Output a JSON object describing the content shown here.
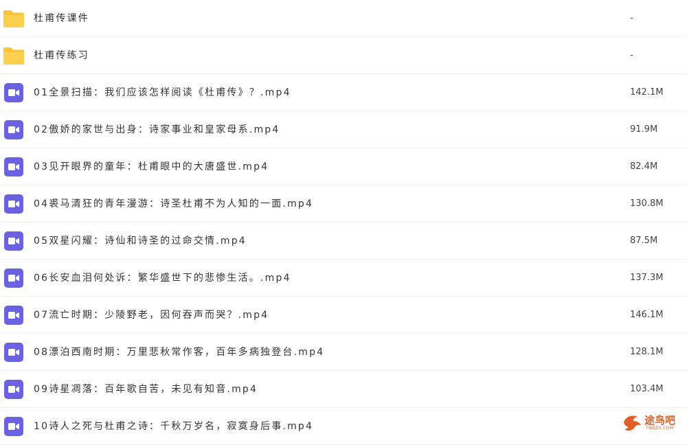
{
  "files": [
    {
      "type": "folder",
      "icon": "folder-icon",
      "name": "杜甫传课件",
      "size": "-"
    },
    {
      "type": "folder",
      "icon": "folder-icon",
      "name": "杜甫传练习",
      "size": "-"
    },
    {
      "type": "video",
      "icon": "video-icon",
      "name": "01全景扫描：我们应该怎样阅读《杜甫传》？.mp4",
      "size": "142.1M"
    },
    {
      "type": "video",
      "icon": "video-icon",
      "name": "02傲娇的家世与出身：诗家事业和皇家母系.mp4",
      "size": "91.9M"
    },
    {
      "type": "video",
      "icon": "video-icon",
      "name": "03见开眼界的童年：杜甫眼中的大唐盛世.mp4",
      "size": "82.4M"
    },
    {
      "type": "video",
      "icon": "video-icon",
      "name": "04裘马清狂的青年漫游：诗圣杜甫不为人知的一面.mp4",
      "size": "130.8M"
    },
    {
      "type": "video",
      "icon": "video-icon",
      "name": "05双星闪耀：诗仙和诗圣的过命交情.mp4",
      "size": "87.5M"
    },
    {
      "type": "video",
      "icon": "video-icon",
      "name": "06长安血泪何处诉：繁华盛世下的悲惨生活。.mp4",
      "size": "137.3M"
    },
    {
      "type": "video",
      "icon": "video-icon",
      "name": "07流亡时期：少陵野老，因何吞声而哭？.mp4",
      "size": "146.1M"
    },
    {
      "type": "video",
      "icon": "video-icon",
      "name": "08漂泊西南时期：万里悲秋常作客，百年多病独登台.mp4",
      "size": "128.1M"
    },
    {
      "type": "video",
      "icon": "video-icon",
      "name": "09诗星凋落：百年歌自苦，未见有知音.mp4",
      "size": "103.4M"
    },
    {
      "type": "video",
      "icon": "video-icon",
      "name": "10诗人之死与杜甫之诗：千秋万岁名，寂寞身后事.mp4",
      "size": ""
    }
  ],
  "watermark": {
    "text": "途鸟吧",
    "sub": "TNBZS.COM"
  },
  "colors": {
    "folder": "#fcc437",
    "video": "#6a62e0",
    "divider": "#f0f1f4",
    "watermark": "#e0602a"
  }
}
